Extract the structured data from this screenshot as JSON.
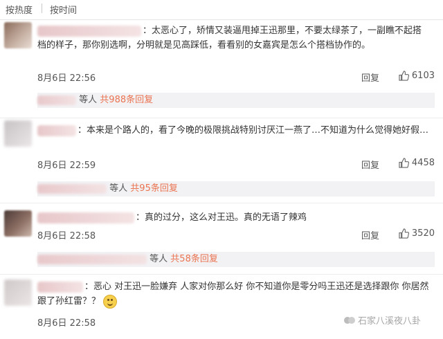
{
  "sort_tabs": {
    "hot": "按热度",
    "time": "按时间"
  },
  "comments": [
    {
      "text": "：太恶心了，矫情又装逼甩掉王迅那里，不要太绿茶了，一副瞧不起搭档的样子，那你别选啊，分明就是见高踩低，看看别的女嘉宾是怎么个搭档协作的。",
      "time": "8月6日 22:56",
      "reply": "回复",
      "likes": "6103",
      "thread": {
        "prefix": "等人",
        "link": "共988条回复"
      }
    },
    {
      "text": "：本来是个路人的，看了今晚的极限挑战特别讨厌江一燕了…不知道为什么觉得她好假…",
      "time": "8月6日 22:59",
      "reply": "回复",
      "likes": "4458",
      "thread": {
        "prefix": "等人",
        "link": "共95条回复"
      }
    },
    {
      "text": "：真的过分，这么对王迅。真的无语了辣鸡",
      "time": "8月6日 22:58",
      "reply": "回复",
      "likes": "3520",
      "thread": {
        "prefix": "等人",
        "link": "共58条回复"
      }
    },
    {
      "text": "：恶心 对王迅一脸嫌弃 人家对你那么好 你不知道你是零分吗王迅还是选择跟你 你居然跟了孙红雷？？",
      "time": "8月6日 22:58"
    }
  ],
  "watermark": {
    "text": "石家八溪夜八卦"
  }
}
